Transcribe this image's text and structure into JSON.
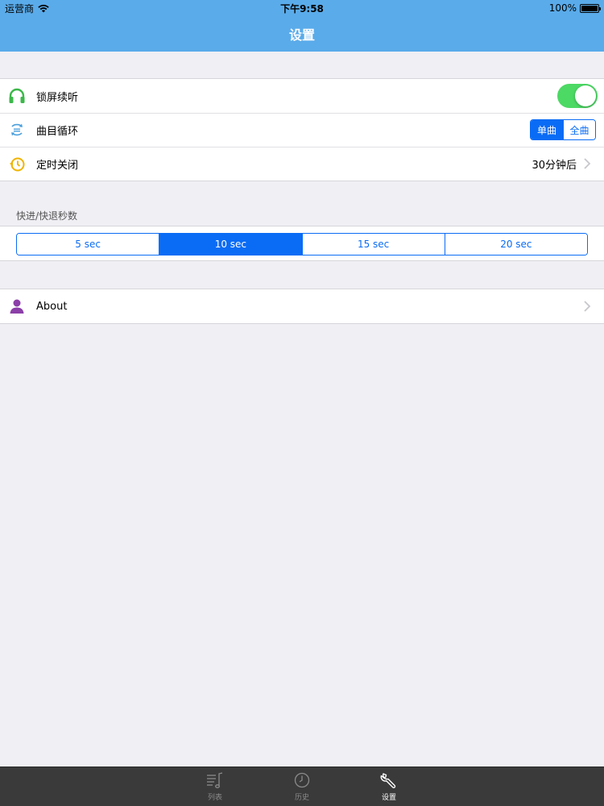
{
  "status_bar": {
    "carrier": "运营商",
    "time": "下午9:58",
    "battery_text": "100%",
    "battery_level": 1.0
  },
  "nav": {
    "title": "设置"
  },
  "settings": {
    "lock_screen": {
      "label": "锁屏续听",
      "icon": "headphones-icon",
      "toggle_on": true
    },
    "loop": {
      "label": "曲目循环",
      "icon": "repeat-icon",
      "options": [
        "单曲",
        "全曲"
      ],
      "selected": 0
    },
    "timer": {
      "label": "定时关闭",
      "icon": "timer-icon",
      "value": "30分钟后"
    }
  },
  "seek_section": {
    "header": "快进/快退秒数",
    "options": [
      "5 sec",
      "10 sec",
      "15 sec",
      "20 sec"
    ],
    "selected": 1
  },
  "about": {
    "label": "About",
    "icon": "person-icon"
  },
  "tabs": [
    {
      "label": "列表",
      "icon": "music-list-icon",
      "active": false
    },
    {
      "label": "历史",
      "icon": "clock-icon",
      "active": false
    },
    {
      "label": "设置",
      "icon": "wrench-icon",
      "active": true
    }
  ],
  "colors": {
    "nav_bg": "#5aabea",
    "accent": "#0a6cf5",
    "toggle_on": "#4cd964",
    "tab_bar_bg": "#3a3a3a"
  }
}
